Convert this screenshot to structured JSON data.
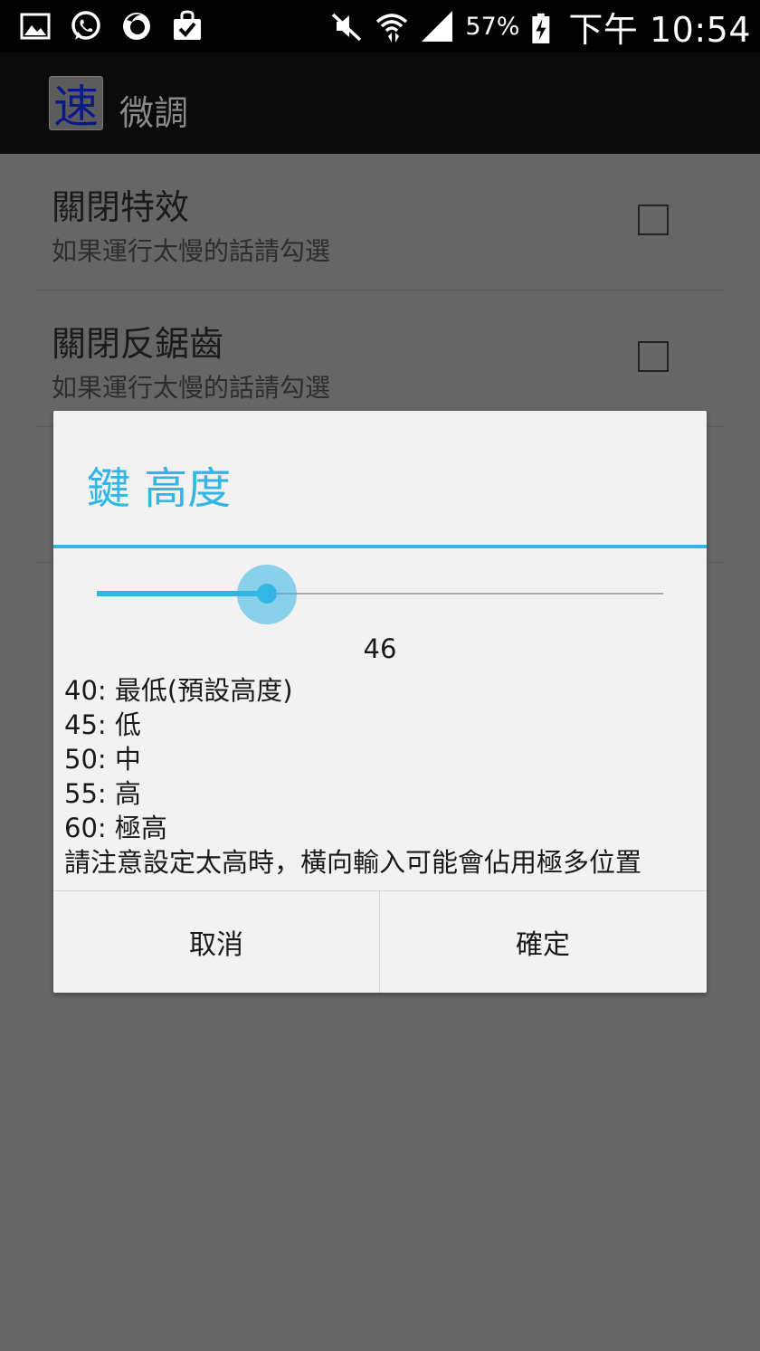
{
  "status_bar": {
    "left_icons": [
      "gallery-icon",
      "whatsapp-icon",
      "firefox-icon",
      "shopping-bag-check-icon"
    ],
    "right_icons": [
      "mute-icon",
      "wifi-icon",
      "cell-signal-icon",
      "battery-charging-icon"
    ],
    "battery_percent": "57%",
    "time": "下午 10:54"
  },
  "action_bar": {
    "app_icon_char": "速",
    "title": "微調"
  },
  "preferences": [
    {
      "title": "關閉特效",
      "summary": "如果運行太慢的話請勾選",
      "checked": false
    },
    {
      "title": "關閉反鋸齒",
      "summary": "如果運行太慢的話請勾選",
      "checked": false
    }
  ],
  "dialog": {
    "title": "鍵 高度",
    "slider": {
      "value": 46,
      "fill_fraction": 0.3
    },
    "value_label": "46",
    "message_lines": [
      "40: 最低(預設高度)",
      "45: 低",
      "50: 中",
      "55: 高",
      "60: 極高",
      "請注意設定太高時，橫向輸入可能會佔用極多位置"
    ],
    "cancel_label": "取消",
    "ok_label": "確定"
  },
  "colors": {
    "accent": "#33b5e5",
    "scrim_background": "#666666",
    "dialog_background": "#f2f2f2"
  }
}
